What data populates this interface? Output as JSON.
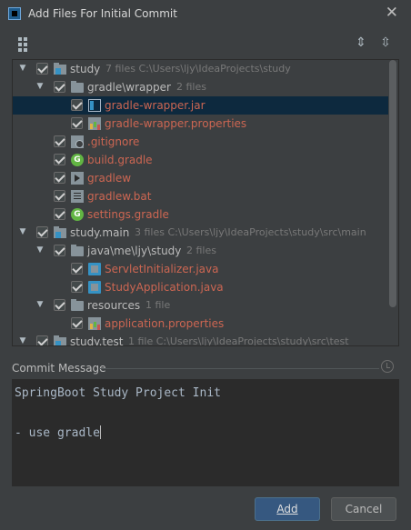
{
  "window": {
    "title": "Add Files For Initial Commit",
    "close_glyph": "✕"
  },
  "toolbar": {
    "group_icon": "group-by-icon",
    "expand_icon": "expand-all-icon",
    "collapse_icon": "collapse-all-icon"
  },
  "tree": [
    {
      "label": "study",
      "meta": "7 files  C:\\Users\\ljy\\IdeaProjects\\study",
      "icon": "module",
      "kind": "dir",
      "depth": 0,
      "chevron": "open"
    },
    {
      "label": "gradle\\wrapper",
      "meta": "2 files",
      "icon": "folder",
      "kind": "dir",
      "depth": 1,
      "chevron": "open"
    },
    {
      "label": "gradle-wrapper.jar",
      "meta": "",
      "icon": "jar",
      "kind": "new",
      "depth": 2,
      "chevron": "",
      "selected": true
    },
    {
      "label": "gradle-wrapper.properties",
      "meta": "",
      "icon": "props",
      "kind": "new",
      "depth": 2,
      "chevron": ""
    },
    {
      "label": ".gitignore",
      "meta": "",
      "icon": "git",
      "kind": "new",
      "depth": 1,
      "chevron": ""
    },
    {
      "label": "build.gradle",
      "meta": "",
      "icon": "gradle",
      "kind": "new",
      "depth": 1,
      "chevron": ""
    },
    {
      "label": "gradlew",
      "meta": "",
      "icon": "exec",
      "kind": "new",
      "depth": 1,
      "chevron": ""
    },
    {
      "label": "gradlew.bat",
      "meta": "",
      "icon": "text",
      "kind": "new",
      "depth": 1,
      "chevron": ""
    },
    {
      "label": "settings.gradle",
      "meta": "",
      "icon": "gradle",
      "kind": "new",
      "depth": 1,
      "chevron": ""
    },
    {
      "label": "study.main",
      "meta": "3 files  C:\\Users\\ljy\\IdeaProjects\\study\\src\\main",
      "icon": "module",
      "kind": "dir",
      "depth": 0,
      "chevron": "open"
    },
    {
      "label": "java\\me\\ljy\\study",
      "meta": "2 files",
      "icon": "folder",
      "kind": "dir",
      "depth": 1,
      "chevron": "open"
    },
    {
      "label": "ServletInitializer.java",
      "meta": "",
      "icon": "java",
      "kind": "new",
      "depth": 2,
      "chevron": ""
    },
    {
      "label": "StudyApplication.java",
      "meta": "",
      "icon": "java",
      "kind": "new",
      "depth": 2,
      "chevron": ""
    },
    {
      "label": "resources",
      "meta": "1 file",
      "icon": "folder",
      "kind": "dir",
      "depth": 1,
      "chevron": "open"
    },
    {
      "label": "application.properties",
      "meta": "",
      "icon": "props",
      "kind": "new",
      "depth": 2,
      "chevron": ""
    },
    {
      "label": "study.test",
      "meta": "1 file  C:\\Users\\ljy\\IdeaProjects\\study\\src\\test",
      "icon": "module",
      "kind": "dir",
      "depth": 0,
      "chevron": "open"
    }
  ],
  "commit": {
    "label": "Commit Message",
    "lines": [
      "SpringBoot Study Project Init",
      "",
      "- use gradle"
    ]
  },
  "buttons": {
    "add": "Add",
    "cancel": "Cancel"
  },
  "colors": {
    "new_file": "#cc6652",
    "selection": "#0d293e",
    "primary_button": "#365880"
  }
}
